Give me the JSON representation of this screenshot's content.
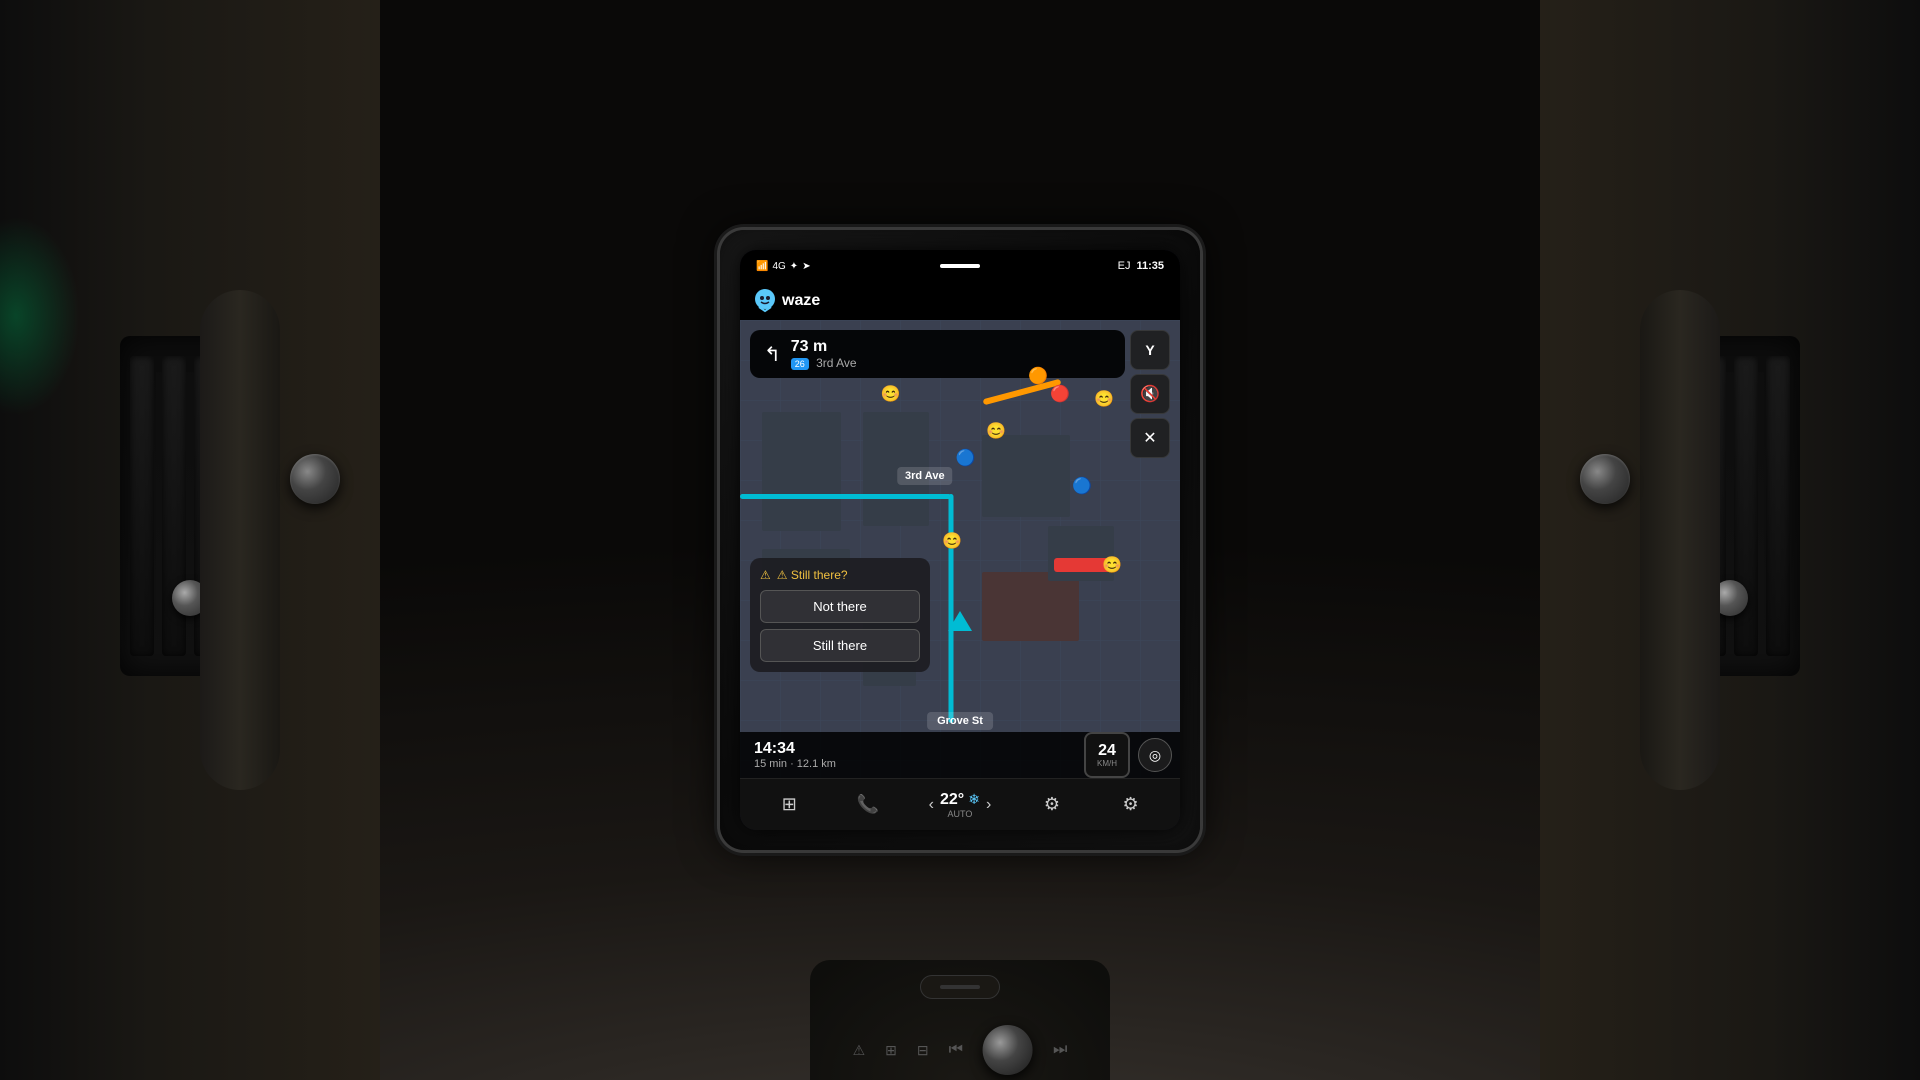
{
  "car": {
    "background_color": "#1a1a1a"
  },
  "phone": {
    "status_bar": {
      "signal": "4G",
      "bluetooth": "BT",
      "location": "GPS",
      "user_initials": "EJ",
      "time": "11:35"
    },
    "app_name": "waze",
    "navigation": {
      "turn_arrow": "↰",
      "distance": "73 m",
      "road_badge": "26",
      "road_name": "3rd Ave",
      "street_label_top": "3rd Ave",
      "street_label_bottom": "Grove St"
    },
    "map_controls": {
      "filter_icon": "Y",
      "volume_icon": "🔇",
      "close_icon": "✕"
    },
    "still_there_popup": {
      "title": "⚠ Still there?",
      "btn_not_there": "Not there",
      "btn_still_there": "Still there"
    },
    "bottom_info": {
      "eta_time": "14:34",
      "trip_details": "15 min · 12.1 km"
    },
    "speed": {
      "value": "24",
      "unit": "KM/H"
    }
  },
  "system_bar": {
    "home_icon": "⊞",
    "phone_icon": "📞",
    "temp_left_arrow": "‹",
    "temp_value": "22°",
    "temp_icon": "❄",
    "temp_right_arrow": "›",
    "temp_mode": "AUTO",
    "steering_icon": "⚙",
    "settings_icon": "⚙"
  }
}
